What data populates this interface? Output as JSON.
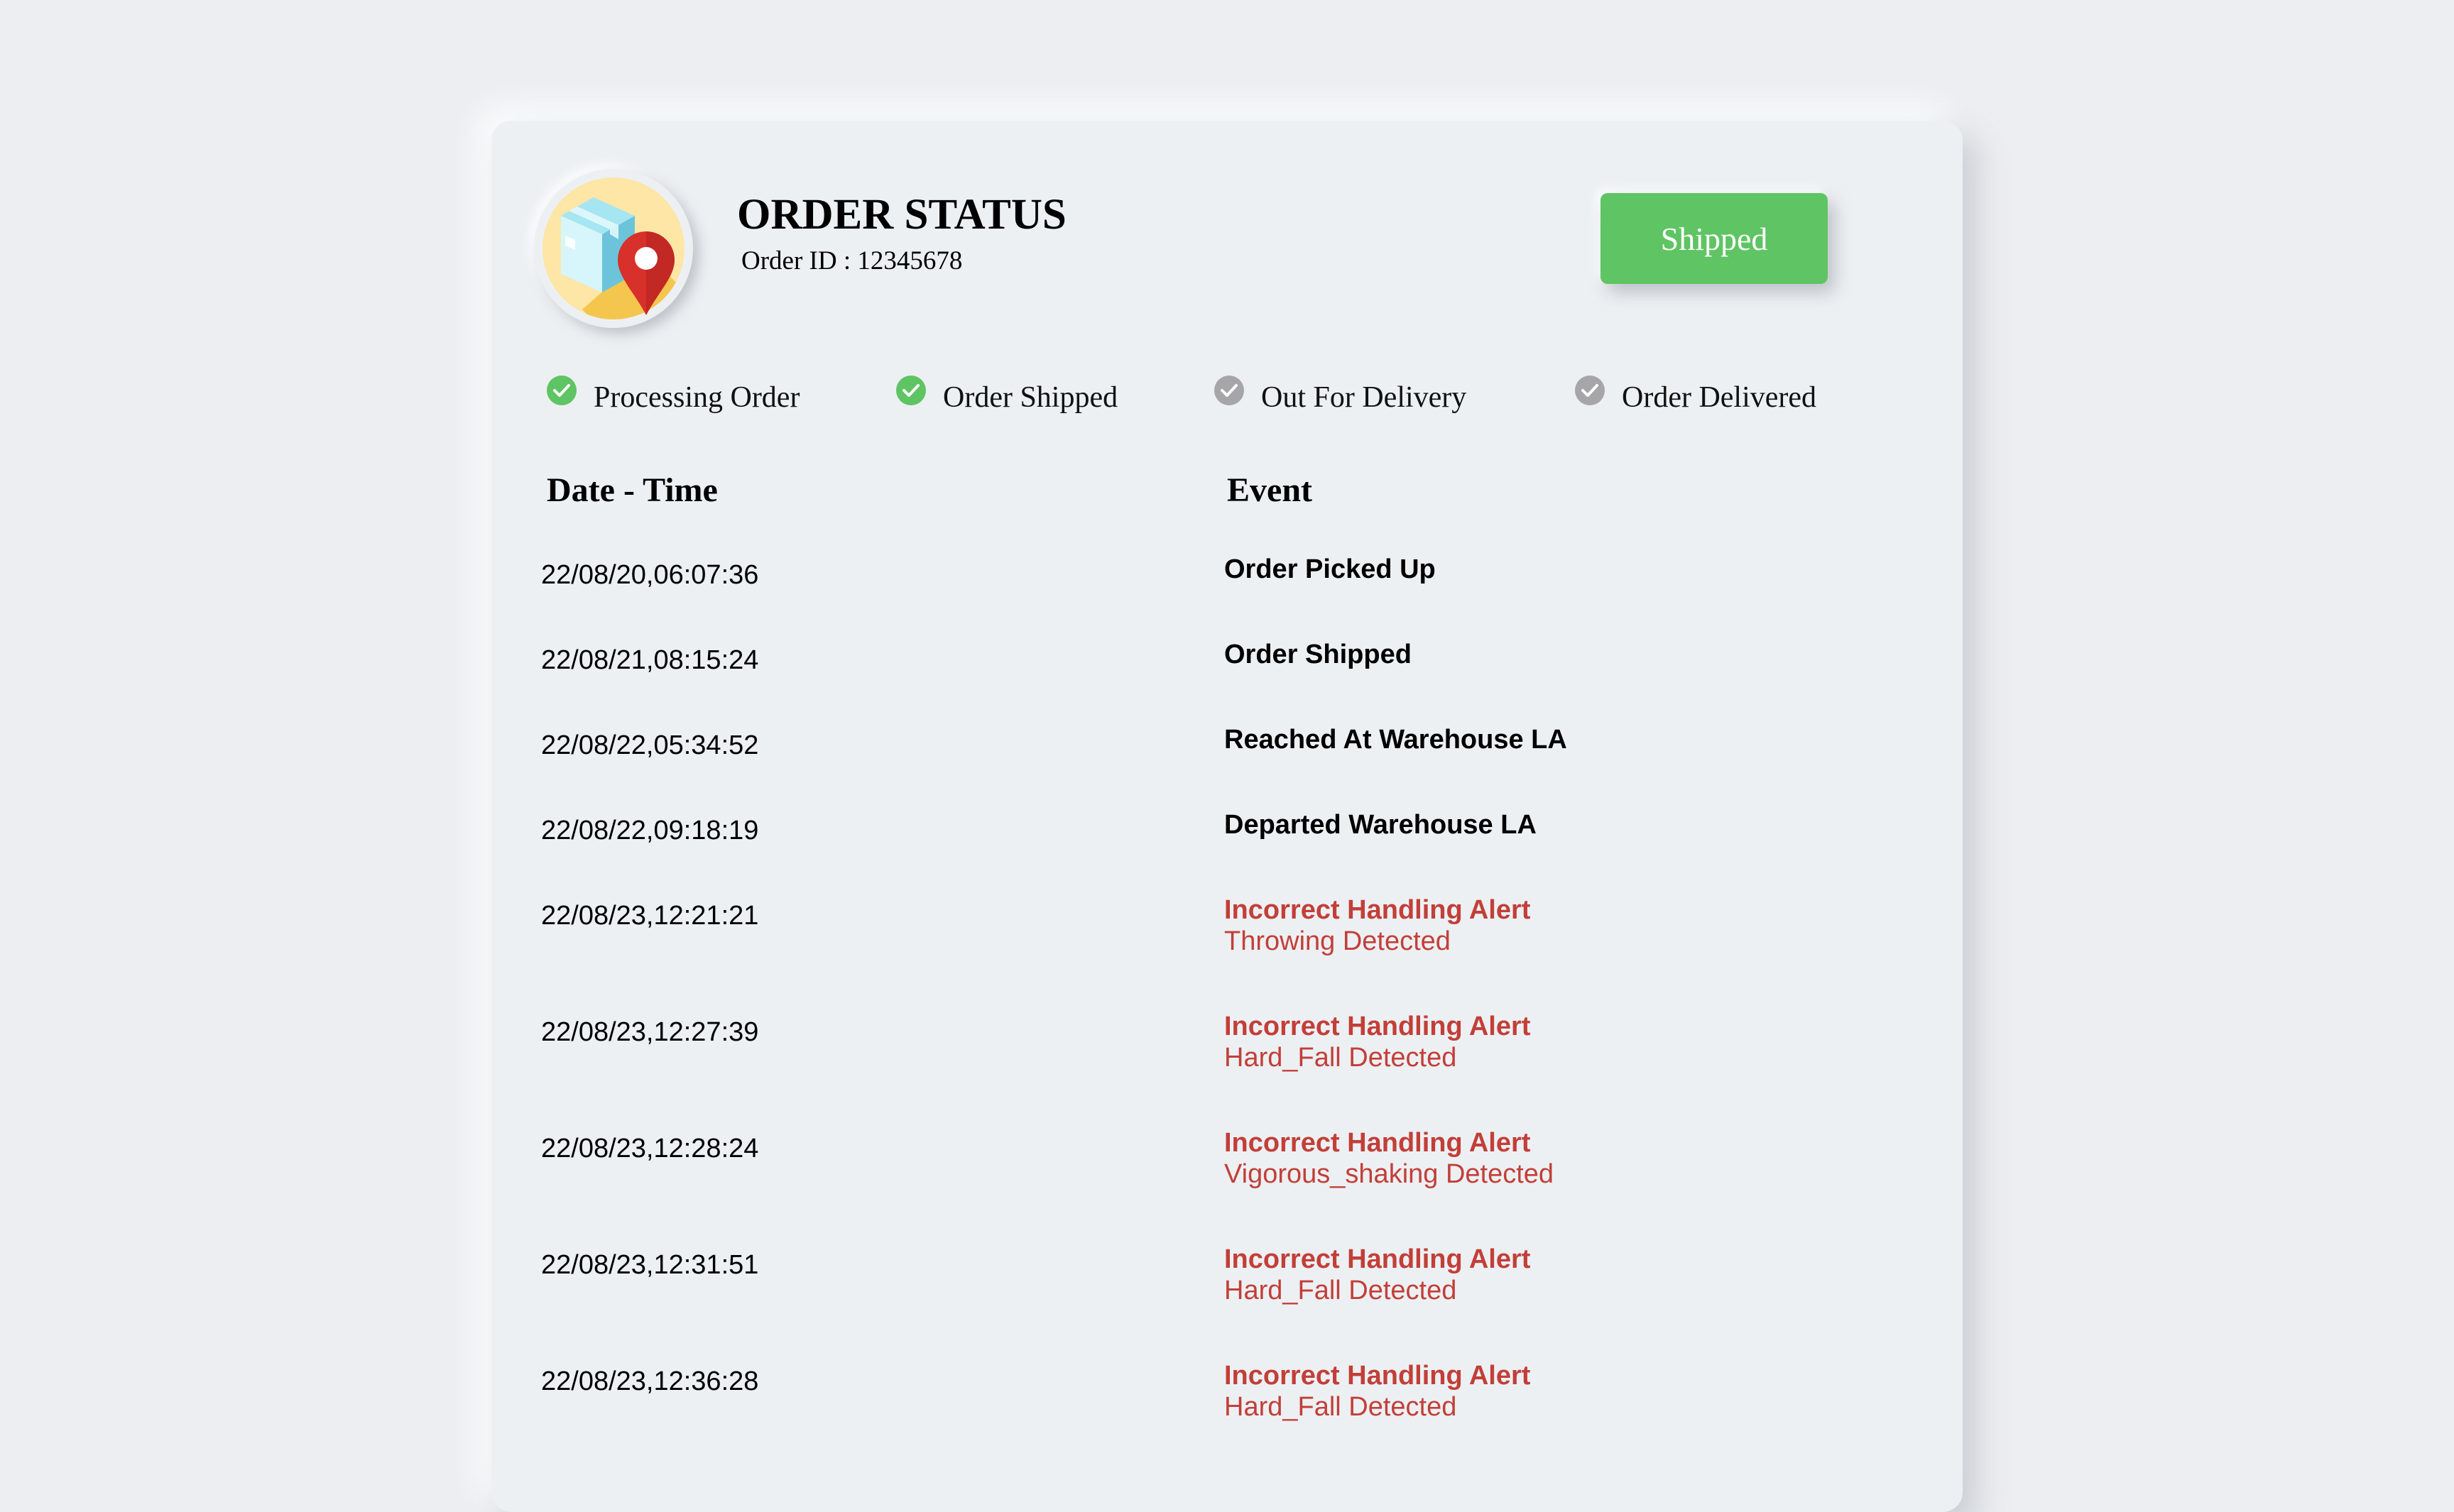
{
  "header": {
    "title": "ORDER STATUS",
    "order_id": "Order ID : 12345678",
    "status_button": "Shipped",
    "icon": "package-location-icon"
  },
  "steps": [
    {
      "label": "Processing Order",
      "done": true
    },
    {
      "label": "Order Shipped",
      "done": true
    },
    {
      "label": "Out For Delivery",
      "done": false
    },
    {
      "label": "Order Delivered",
      "done": false
    }
  ],
  "table": {
    "columns": [
      "Date - Time",
      "Event"
    ],
    "rows": [
      {
        "date": "22/08/20,06:07:36",
        "event": "Order Picked Up",
        "alert": false
      },
      {
        "date": "22/08/21,08:15:24",
        "event": "Order Shipped",
        "alert": false
      },
      {
        "date": "22/08/22,05:34:52",
        "event": "Reached At Warehouse LA",
        "alert": false
      },
      {
        "date": "22/08/22,09:18:19",
        "event": "Departed Warehouse LA",
        "alert": false
      },
      {
        "date": "22/08/23,12:21:21",
        "event": "Incorrect Handling Alert",
        "detail": "Throwing Detected",
        "alert": true
      },
      {
        "date": "22/08/23,12:27:39",
        "event": "Incorrect Handling Alert",
        "detail": "Hard_Fall Detected",
        "alert": true
      },
      {
        "date": "22/08/23,12:28:24",
        "event": "Incorrect Handling Alert",
        "detail": "Vigorous_shaking Detected",
        "alert": true
      },
      {
        "date": "22/08/23,12:31:51",
        "event": "Incorrect Handling Alert",
        "detail": "Hard_Fall Detected",
        "alert": true
      },
      {
        "date": "22/08/23,12:36:28",
        "event": "Incorrect Handling Alert",
        "detail": "Hard_Fall Detected",
        "alert": true
      }
    ]
  },
  "colors": {
    "background": "#eceef1",
    "card": "#edf0f3",
    "status_button": "#5fc463",
    "step_done": "#5fc463",
    "step_pending": "#a6a6a8",
    "alert_text": "#c23f38"
  }
}
